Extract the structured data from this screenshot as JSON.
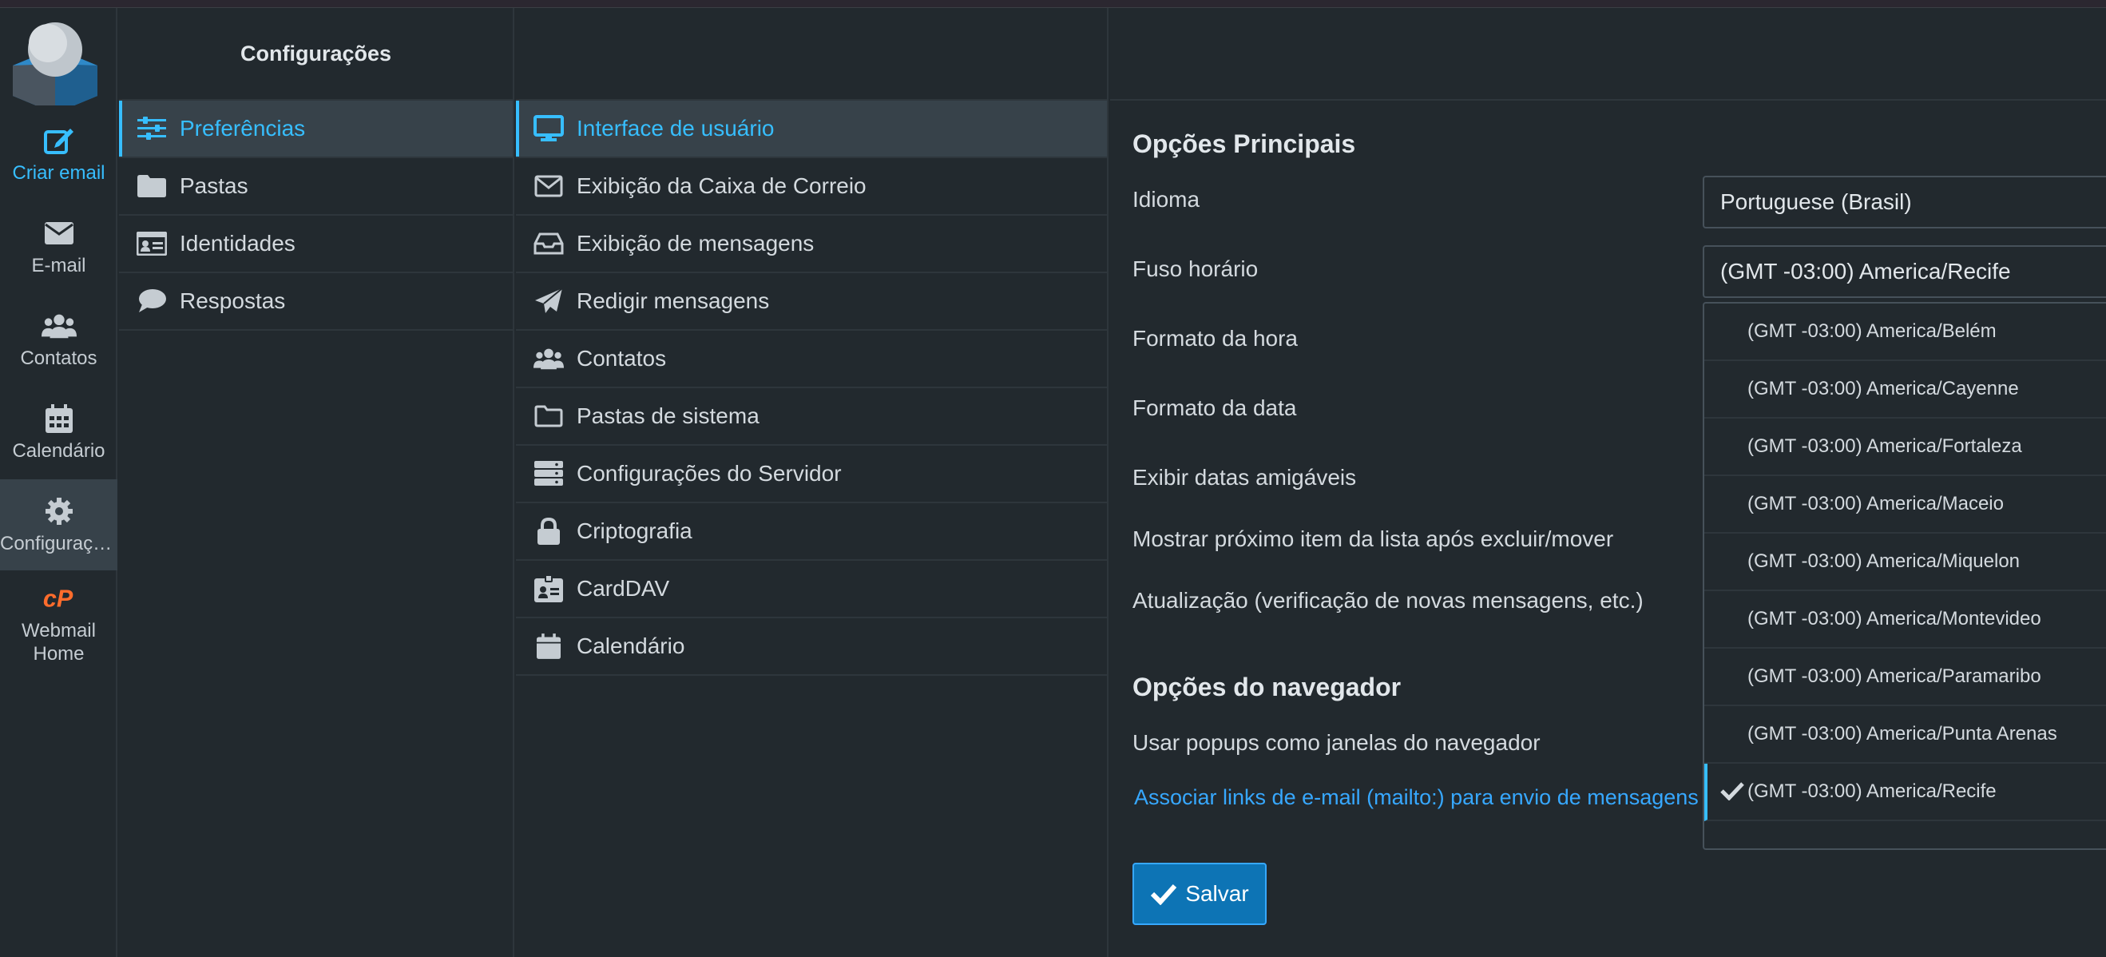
{
  "colors": {
    "accent": "#37beff",
    "link": "#37a8ff",
    "button": "#0d74b5",
    "cpanel": "#ff6c2c"
  },
  "nav": {
    "items": [
      {
        "label": "Criar email",
        "icon": "compose-icon"
      },
      {
        "label": "E-mail",
        "icon": "envelope-icon"
      },
      {
        "label": "Contatos",
        "icon": "users-icon"
      },
      {
        "label": "Calendário",
        "icon": "calendar-icon"
      },
      {
        "label": "Configurações",
        "icon": "gear-icon"
      },
      {
        "label": "Webmail Home",
        "icon": "cpanel-icon"
      }
    ]
  },
  "settings": {
    "title": "Configurações",
    "items": [
      {
        "label": "Preferências",
        "icon": "sliders-icon"
      },
      {
        "label": "Pastas",
        "icon": "folder-icon"
      },
      {
        "label": "Identidades",
        "icon": "id-card-icon"
      },
      {
        "label": "Respostas",
        "icon": "comment-icon"
      }
    ]
  },
  "sections": {
    "items": [
      {
        "label": "Interface de usuário",
        "icon": "monitor-icon"
      },
      {
        "label": "Exibição da Caixa de Correio",
        "icon": "envelope-outline-icon"
      },
      {
        "label": "Exibição de mensagens",
        "icon": "inbox-icon"
      },
      {
        "label": "Redigir mensagens",
        "icon": "paper-plane-icon"
      },
      {
        "label": "Contatos",
        "icon": "users-icon"
      },
      {
        "label": "Pastas de sistema",
        "icon": "folder-outline-icon"
      },
      {
        "label": "Configurações do Servidor",
        "icon": "server-icon"
      },
      {
        "label": "Criptografia",
        "icon": "lock-icon"
      },
      {
        "label": "CardDAV",
        "icon": "address-card-icon"
      },
      {
        "label": "Calendário",
        "icon": "calendar-icon"
      }
    ]
  },
  "main": {
    "main_title": "Opções Principais",
    "browser_title": "Opções do navegador",
    "labels": {
      "language": "Idioma",
      "timezone": "Fuso horário",
      "time_format": "Formato da hora",
      "date_format": "Formato da data",
      "pretty_dates": "Exibir datas amigáveis",
      "next_item": "Mostrar próximo item da lista após excluir/mover",
      "refresh": "Atualização (verificação de novas mensagens, etc.)",
      "popups": "Usar popups como janelas do navegador",
      "mailto_link": "Associar links de e-mail (mailto:) para envio de mensagens"
    },
    "language_value": "Portuguese (Brasil)",
    "timezone_value": "(GMT -03:00) America/Recife",
    "timezone_options": [
      "(GMT -03:00) America/Belém",
      "(GMT -03:00) America/Cayenne",
      "(GMT -03:00) America/Fortaleza",
      "(GMT -03:00) America/Maceio",
      "(GMT -03:00) America/Miquelon",
      "(GMT -03:00) America/Montevideo",
      "(GMT -03:00) America/Paramaribo",
      "(GMT -03:00) America/Punta Arenas",
      "(GMT -03:00) America/Recife"
    ],
    "save_label": "Salvar"
  }
}
